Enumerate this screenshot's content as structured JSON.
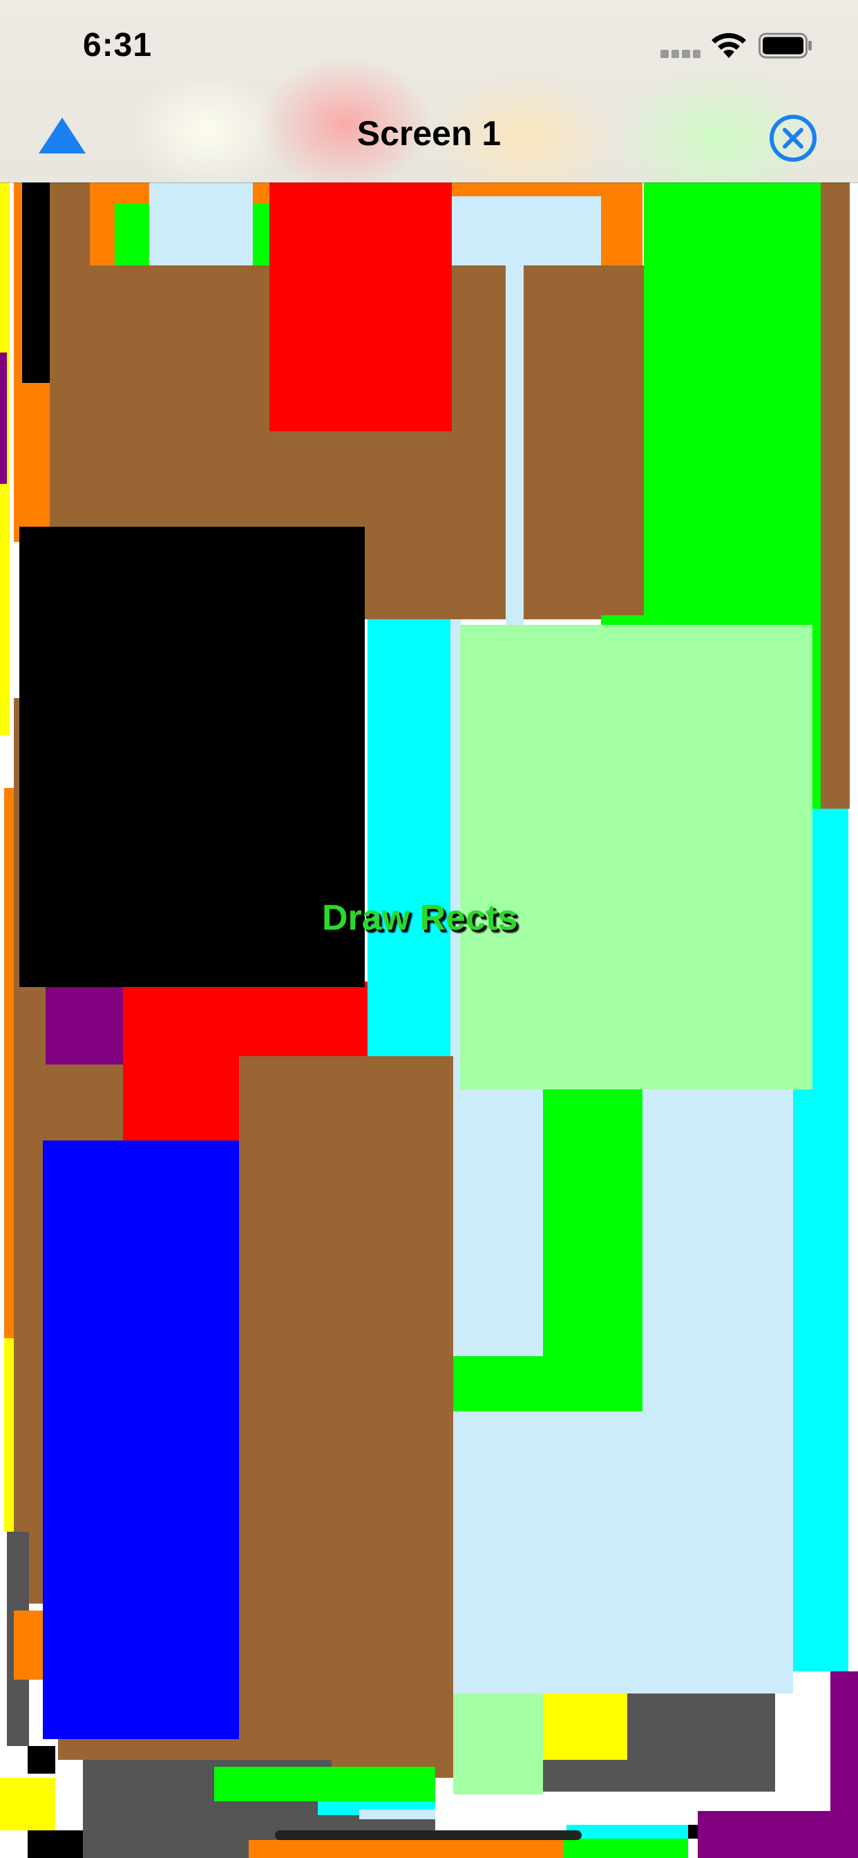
{
  "status_bar": {
    "time": "6:31",
    "icons": [
      "cellular-signal-icon",
      "wifi-icon",
      "battery-icon"
    ]
  },
  "nav_bar": {
    "title": "Screen 1",
    "left_icon": "triangle-up-icon",
    "right_icon": "close-circle-icon",
    "accent_color": "#1a7ff0"
  },
  "canvas": {
    "label": "Draw Rects",
    "label_color": "#2bd92b",
    "palette": [
      "#996633",
      "#ff0000",
      "#00ff00",
      "#000000",
      "#0000ff",
      "#00ffff",
      "#a3ffa3",
      "#ccecfb",
      "#ff8000",
      "#ffff00",
      "#800080",
      "#555555",
      "#ffffff"
    ]
  }
}
